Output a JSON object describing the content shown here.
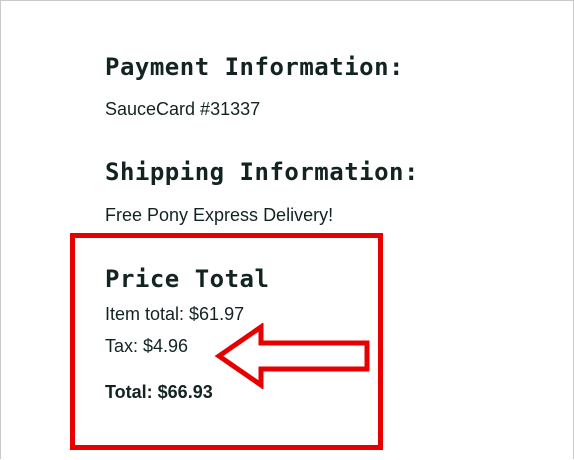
{
  "payment": {
    "heading": "Payment Information:",
    "value": "SauceCard #31337"
  },
  "shipping": {
    "heading": "Shipping Information:",
    "value": "Free Pony Express Delivery!"
  },
  "price": {
    "heading": "Price Total",
    "item_total": "Item total: $61.97",
    "tax": "Tax: $4.96",
    "total": "Total: $66.93"
  },
  "annotation": {
    "highlight_color": "#e60000",
    "arrow_icon": "left-arrow-icon"
  }
}
